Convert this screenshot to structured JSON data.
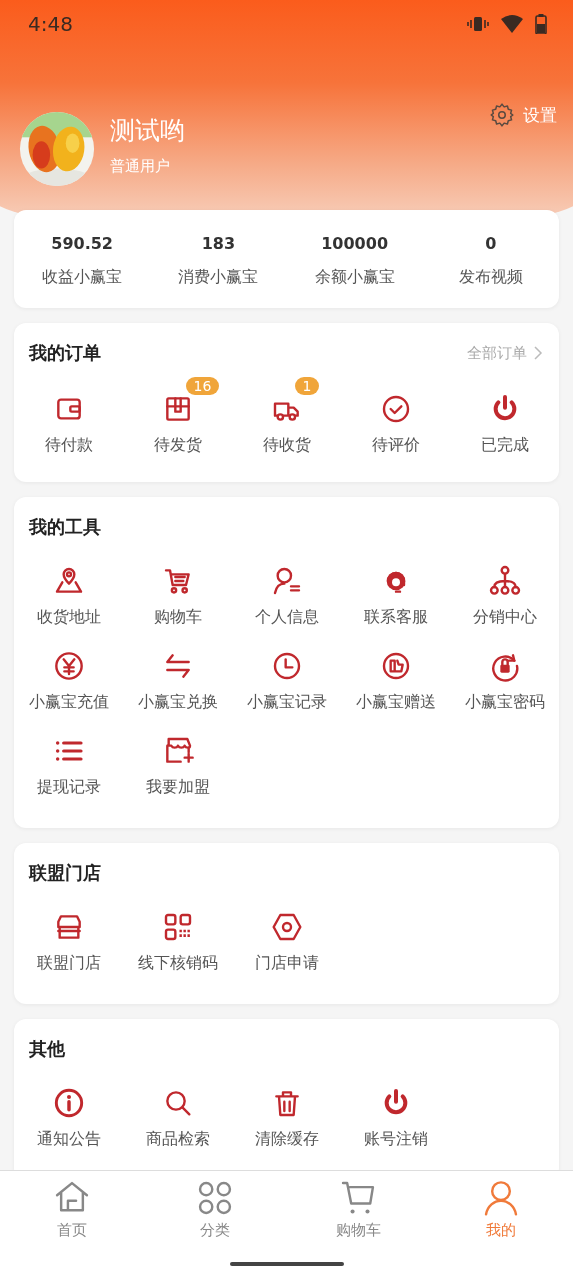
{
  "status_bar": {
    "time": "4:48"
  },
  "profile": {
    "name": "测试哟",
    "role": "普通用户",
    "settings": "设置"
  },
  "stats": [
    {
      "value": "590.52",
      "label": "收益小赢宝"
    },
    {
      "value": "183",
      "label": "消费小赢宝"
    },
    {
      "value": "100000",
      "label": "余额小赢宝"
    },
    {
      "value": "0",
      "label": "发布视频"
    }
  ],
  "orders": {
    "title": "我的订单",
    "link": "全部订单",
    "items": [
      {
        "label": "待付款"
      },
      {
        "label": "待发货",
        "badge": "16"
      },
      {
        "label": "待收货",
        "badge": "1"
      },
      {
        "label": "待评价"
      },
      {
        "label": "已完成"
      }
    ]
  },
  "sections": [
    {
      "title": "我的工具",
      "items": [
        "收货地址",
        "购物车",
        "个人信息",
        "联系客服",
        "分销中心",
        "小赢宝充值",
        "小赢宝兑换",
        "小赢宝记录",
        "小赢宝赠送",
        "小赢宝密码",
        "提现记录",
        "我要加盟"
      ]
    },
    {
      "title": "联盟门店",
      "items": [
        "联盟门店",
        "线下核销码",
        "门店申请"
      ]
    },
    {
      "title": "其他",
      "items": [
        "通知公告",
        "商品检索",
        "清除缓存",
        "账号注销"
      ]
    }
  ],
  "tab_bar": [
    {
      "label": "首页",
      "selected": false
    },
    {
      "label": "分类",
      "selected": false
    },
    {
      "label": "购物车",
      "selected": false
    },
    {
      "label": "我的",
      "selected": true
    }
  ]
}
